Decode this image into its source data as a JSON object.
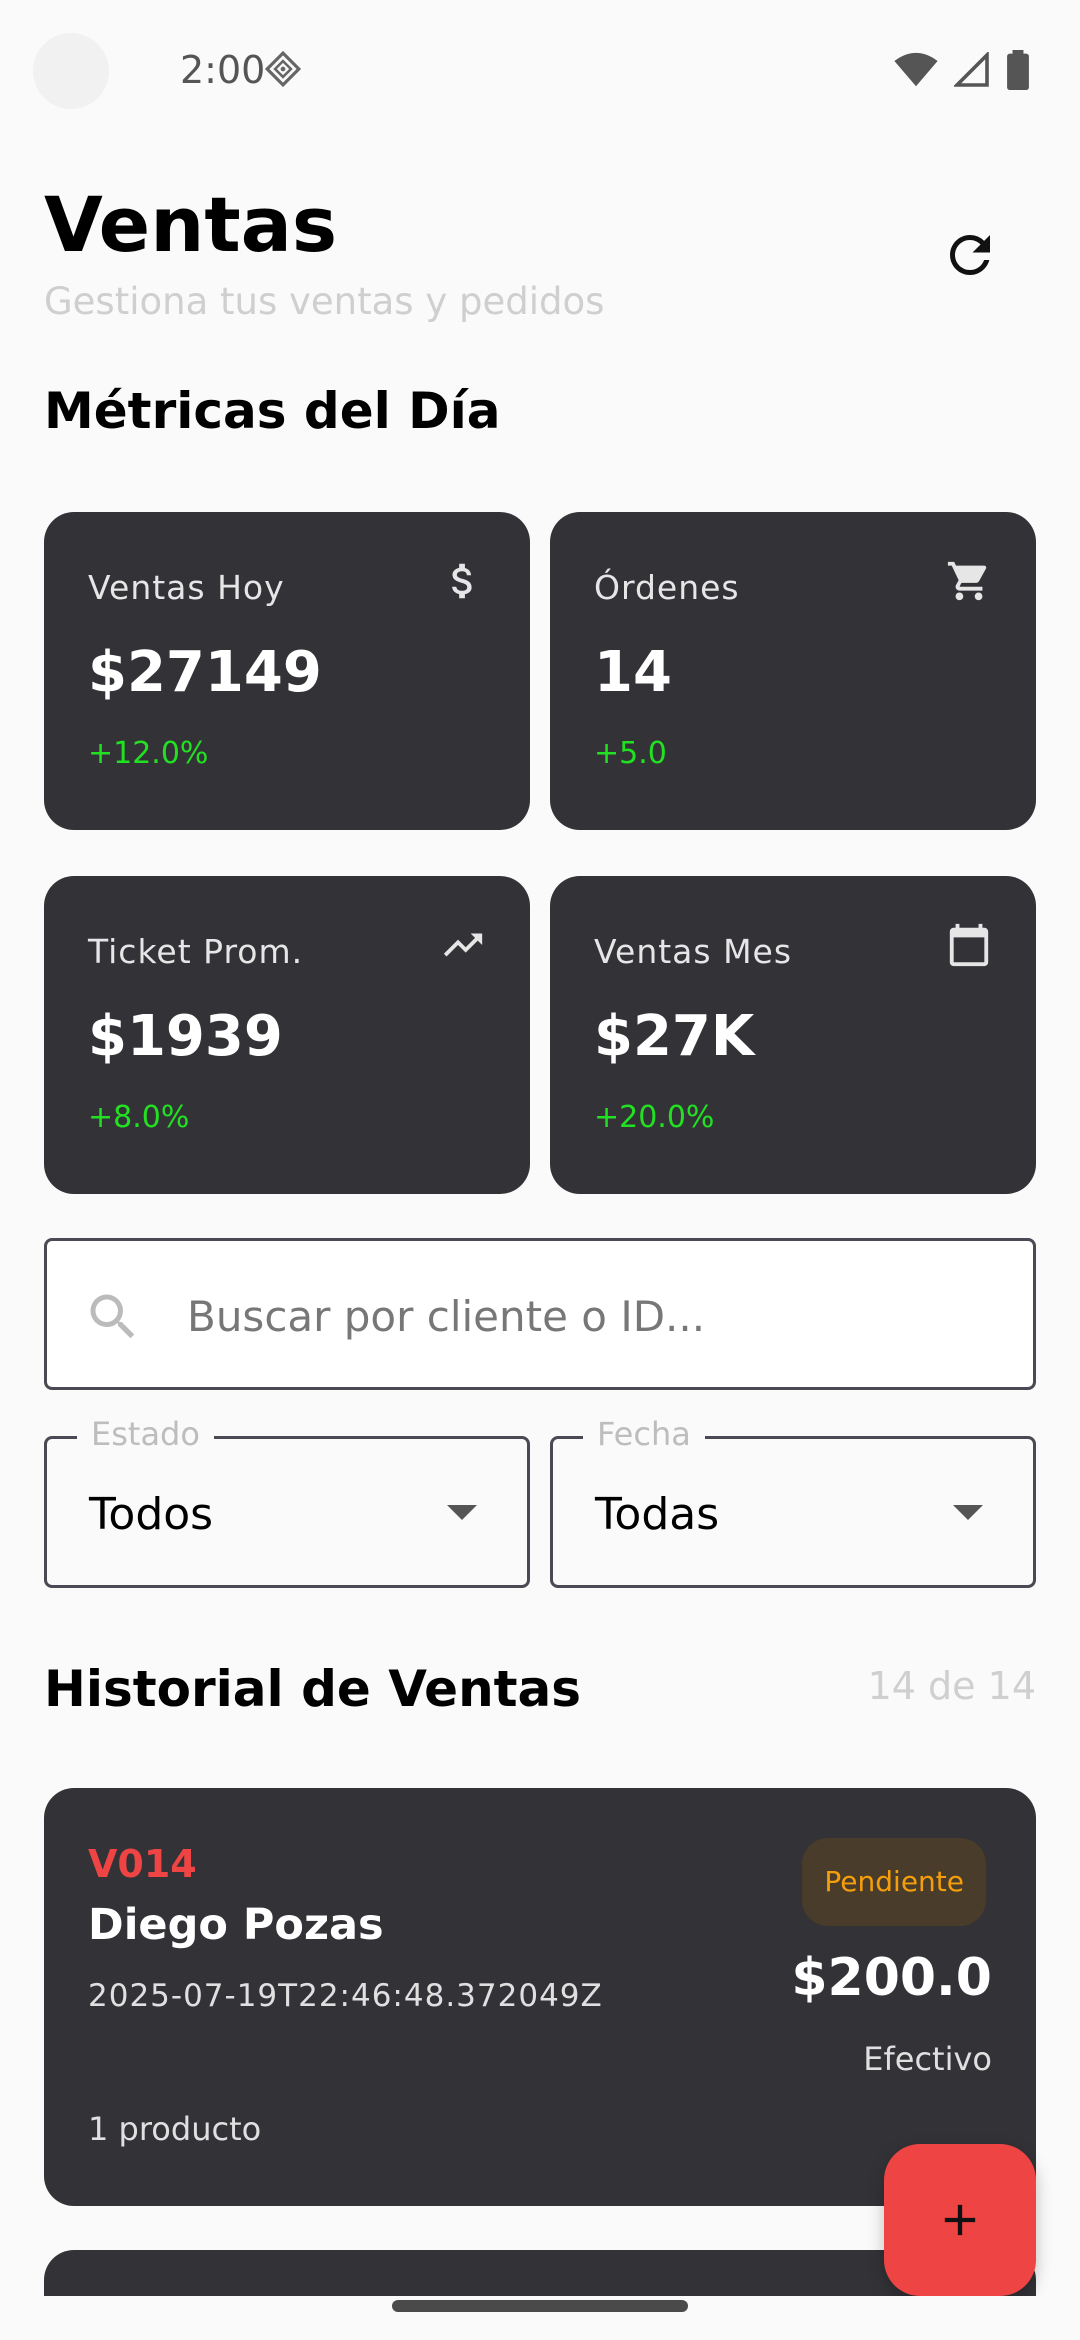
{
  "status_bar": {
    "time": "2:00"
  },
  "header": {
    "title": "Ventas",
    "subtitle": "Gestiona tus ventas y pedidos"
  },
  "metrics_section": {
    "title": "Métricas del Día"
  },
  "metrics": [
    {
      "label": "Ventas Hoy",
      "value": "$27149",
      "change": "+12.0%",
      "icon": "dollar-icon"
    },
    {
      "label": "Órdenes",
      "value": "14",
      "change": "+5.0",
      "icon": "cart-icon"
    },
    {
      "label": "Ticket Prom.",
      "value": "$1939",
      "change": "+8.0%",
      "icon": "trending-up-icon"
    },
    {
      "label": "Ventas Mes",
      "value": "$27K",
      "change": "+20.0%",
      "icon": "calendar-icon"
    }
  ],
  "search": {
    "placeholder": "Buscar por cliente o ID..."
  },
  "filters": {
    "status": {
      "label": "Estado",
      "value": "Todos"
    },
    "date": {
      "label": "Fecha",
      "value": "Todas"
    }
  },
  "history": {
    "title": "Historial de Ventas",
    "count": "14 de 14",
    "sales": [
      {
        "id": "V014",
        "client": "Diego Pozas",
        "date": "2025-07-19T22:46:48.372049Z",
        "status": "Pendiente",
        "amount": "$200.0",
        "payment_method": "Efectivo",
        "products": "1 producto"
      }
    ]
  },
  "colors": {
    "card_bg": "#333237",
    "accent_red": "#ef4444",
    "positive_green": "#22e022",
    "pending_orange": "#f59e0b"
  }
}
